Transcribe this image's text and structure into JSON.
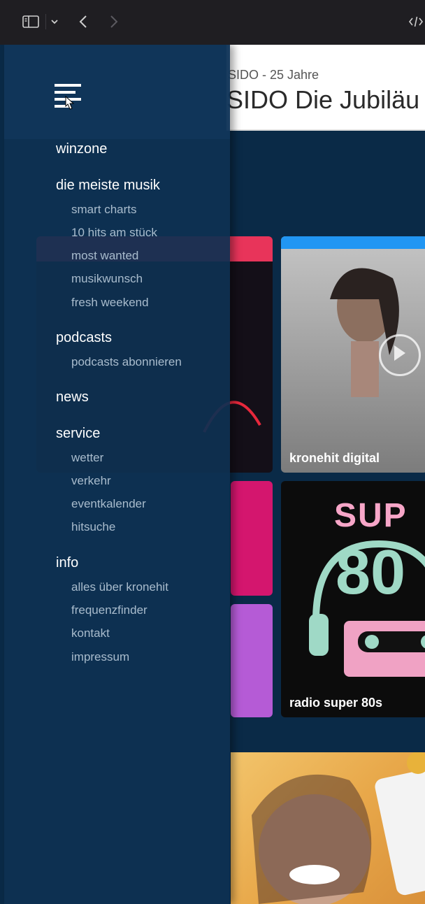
{
  "toolbar": {
    "sidebar_icon": "sidebar-icon",
    "chevron_icon": "chevron-down-icon",
    "back_icon": "chevron-left-icon",
    "forward_icon": "chevron-right-icon",
    "code_icon": "code-icon"
  },
  "header": {
    "subtitle": "SIDO - 25 Jahre",
    "title": "SIDO Die Jubiläu"
  },
  "drawer": {
    "menu_icon": "menu-icon",
    "sections": {
      "winzone": "winzone",
      "musik": "die meiste musik",
      "podcasts": "podcasts",
      "news": "news",
      "service": "service",
      "info": "info"
    },
    "musik_items": [
      "smart charts",
      "10 hits am stück",
      "most wanted",
      "musikwunsch",
      "fresh weekend"
    ],
    "podcasts_items": [
      "podcasts abonnieren"
    ],
    "service_items": [
      "wetter",
      "verkehr",
      "eventkalender",
      "hitsuche"
    ],
    "info_items": [
      "alles über kronehit",
      "frequenzfinder",
      "kontakt",
      "impressum"
    ]
  },
  "tiles": {
    "demi_label": "kronehit digital",
    "super_label": "radio super 80s",
    "super_art": "SUP",
    "super_art_num": "80"
  },
  "colors": {
    "drawer_bg": "#0e3052",
    "page_bg": "#0a2a47",
    "accent_blue": "#2196f3"
  }
}
